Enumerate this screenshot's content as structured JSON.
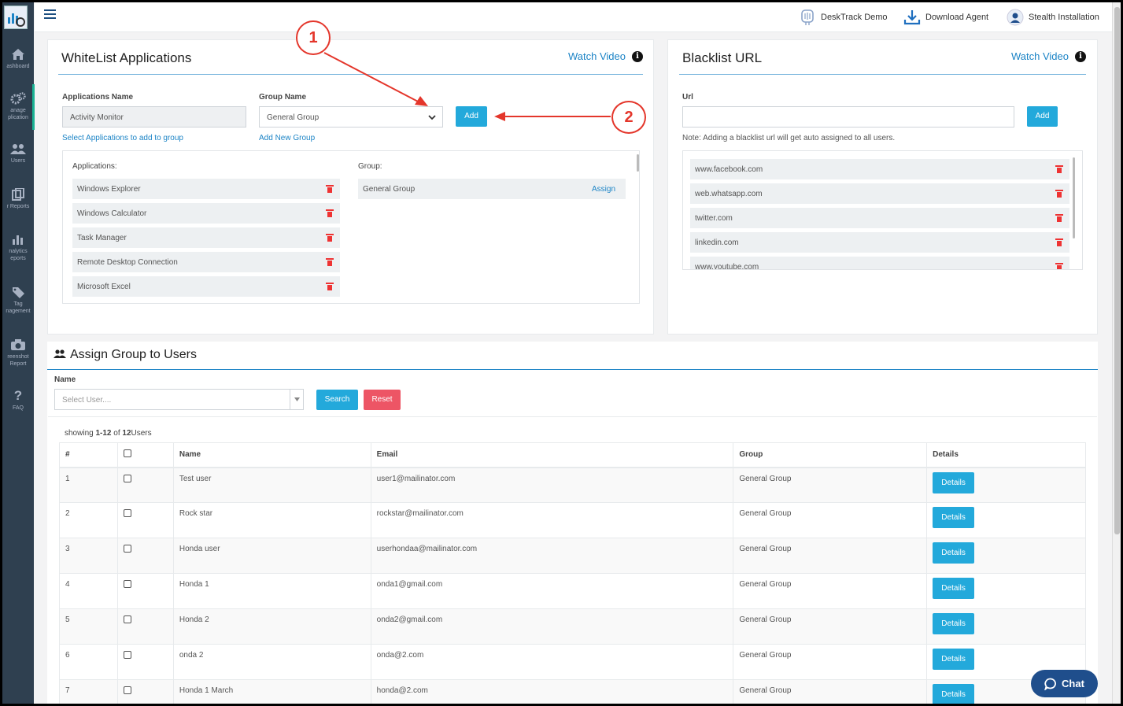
{
  "topbar": {
    "links": [
      {
        "label": "DeskTrack Demo",
        "icon": "brain-icon"
      },
      {
        "label": "Download Agent",
        "icon": "download-icon"
      },
      {
        "label": "Stealth Installation",
        "icon": "user-icon"
      }
    ]
  },
  "sidebar": {
    "items": [
      {
        "label": "ashboard",
        "icon": "home-icon"
      },
      {
        "label": "anage plication",
        "icon": "gears-icon"
      },
      {
        "label": "Users",
        "icon": "users-icon"
      },
      {
        "label": "r Reports",
        "icon": "reports-icon"
      },
      {
        "label": "nalytics eports",
        "icon": "bar-chart-icon"
      },
      {
        "label": "Tag nagement",
        "icon": "tags-icon"
      },
      {
        "label": "reenshot Report",
        "icon": "camera-icon"
      },
      {
        "label": "FAQ",
        "icon": "question-icon"
      }
    ]
  },
  "whitelist": {
    "title": "WhiteList Applications",
    "watch_video": "Watch Video",
    "app_name_label": "Applications Name",
    "app_name_value": "Activity Monitor",
    "group_name_label": "Group Name",
    "group_name_value": "General Group",
    "add_label": "Add",
    "select_apps_link": "Select Applications to add to group",
    "add_group_link": "Add New Group",
    "applications_heading": "Applications:",
    "group_heading": "Group:",
    "applications": [
      "Windows Explorer",
      "Windows Calculator",
      "Task Manager",
      "Remote Desktop Connection",
      "Microsoft Excel"
    ],
    "groups": [
      {
        "name": "General Group",
        "action": "Assign"
      }
    ]
  },
  "blacklist": {
    "title": "Blacklist URL",
    "watch_video": "Watch Video",
    "url_label": "Url",
    "url_value": "",
    "add_label": "Add",
    "note": "Note: Adding a blacklist url will get auto assigned to all users.",
    "urls": [
      "www.facebook.com",
      "web.whatsapp.com",
      "twitter.com",
      "linkedin.com",
      "www.youtube.com"
    ]
  },
  "annotations": [
    "1",
    "2"
  ],
  "assign": {
    "title": "Assign Group to Users",
    "name_label": "Name",
    "select_placeholder": "Select User....",
    "search_label": "Search",
    "reset_label": "Reset",
    "showing_prefix": "showing ",
    "showing_range": "1-12",
    "showing_of": " of ",
    "showing_total": "12",
    "showing_suffix": "Users",
    "columns": [
      "#",
      "",
      "Name",
      "Email",
      "Group",
      "Details"
    ],
    "rows": [
      {
        "num": "1",
        "name": "Test user",
        "email": "user1@mailinator.com",
        "group": "General Group",
        "details": "Details"
      },
      {
        "num": "2",
        "name": "Rock star",
        "email": "rockstar@mailinator.com",
        "group": "General Group",
        "details": "Details"
      },
      {
        "num": "3",
        "name": "Honda user",
        "email": "userhondaa@mailinator.com",
        "group": "General Group",
        "details": "Details"
      },
      {
        "num": "4",
        "name": "Honda 1",
        "email": "onda1@gmail.com",
        "group": "General Group",
        "details": "Details"
      },
      {
        "num": "5",
        "name": "Honda 2",
        "email": "onda2@gmail.com",
        "group": "General Group",
        "details": "Details"
      },
      {
        "num": "6",
        "name": "onda 2",
        "email": "onda@2.com",
        "group": "General Group",
        "details": "Details"
      },
      {
        "num": "7",
        "name": "Honda 1 March",
        "email": "honda@2.com",
        "group": "General Group",
        "details": "Details"
      }
    ]
  },
  "chat": {
    "label": "Chat"
  },
  "colors": {
    "accent": "#23a9db",
    "danger": "#ed5565",
    "sidebar": "#2f4050",
    "annotation": "#e4362b"
  }
}
